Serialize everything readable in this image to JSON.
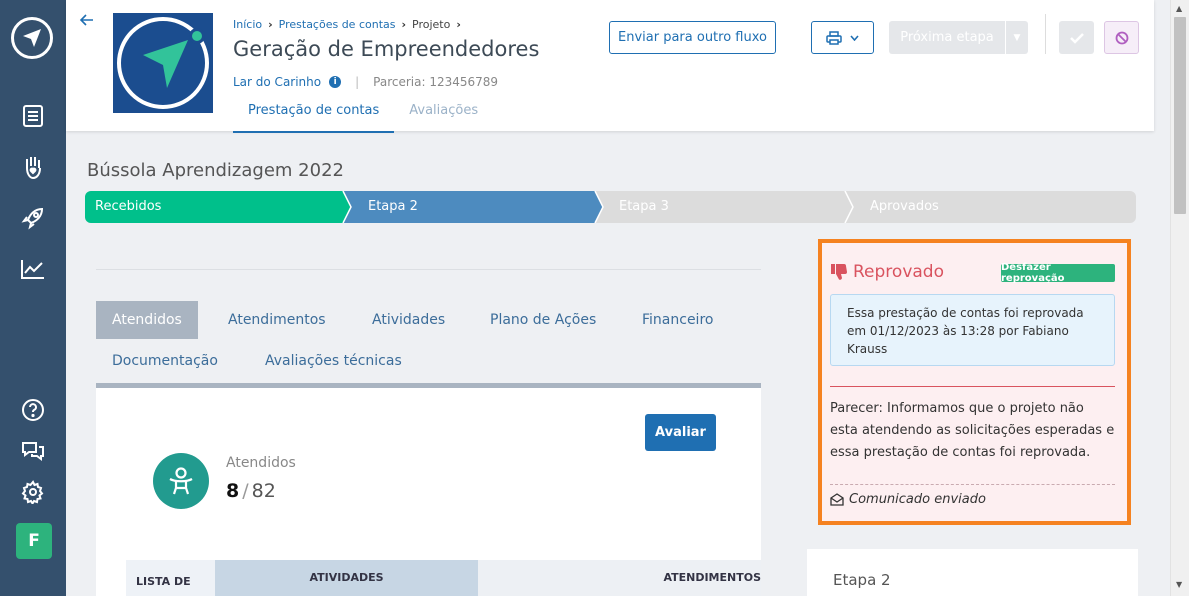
{
  "sidebar": {
    "avatar_letter": "F",
    "icons": [
      "compass-logo-icon",
      "document-icon",
      "hand-heart-icon",
      "rocket-icon",
      "chart-icon",
      "help-icon",
      "chat-icon",
      "gear-icon"
    ]
  },
  "header": {
    "breadcrumb": [
      "Início",
      "Prestações de contas",
      "Projeto"
    ],
    "title": "Geração de Empreendedores",
    "organization": "Lar do Carinho",
    "partnership": "Parceria: 123456789",
    "tabs": [
      {
        "label": "Prestação de contas",
        "active": true
      },
      {
        "label": "Avaliações",
        "active": false
      }
    ],
    "send_button": "Enviar para outro fluxo",
    "next_button": "Próxima etapa"
  },
  "program": {
    "title": "Bússola Aprendizagem 2022",
    "steps": [
      "Recebidos",
      "Etapa 2",
      "Etapa 3",
      "Aprovados"
    ],
    "colors": {
      "done": "#00c08b",
      "current": "#4d8bbf",
      "pending": "#dcdcdc"
    }
  },
  "content_tabs": [
    "Atendidos",
    "Atendimentos",
    "Atividades",
    "Plano de Ações",
    "Financeiro",
    "Documentação",
    "Avaliações técnicas"
  ],
  "atendidos": {
    "evaluate_button": "Avaliar",
    "label": "Atendidos",
    "count": "8",
    "total": "82"
  },
  "table": {
    "headers": [
      "LISTA DE",
      "ATIVIDADES",
      "ATENDIMENTOS"
    ]
  },
  "rejection": {
    "title": "Reprovado",
    "undo_button": "Desfazer reprovação",
    "message": "Essa prestação de contas foi reprovada em 01/12/2023 às 13:28 por Fabiano Krauss",
    "parecer": "Parecer: Informamos que o projeto não esta atendendo as solicitações esperadas e essa prestação de contas foi reprovada.",
    "sent": "Comunicado enviado",
    "accent": "#f58220"
  },
  "next_stage": {
    "label": "Etapa 2"
  }
}
